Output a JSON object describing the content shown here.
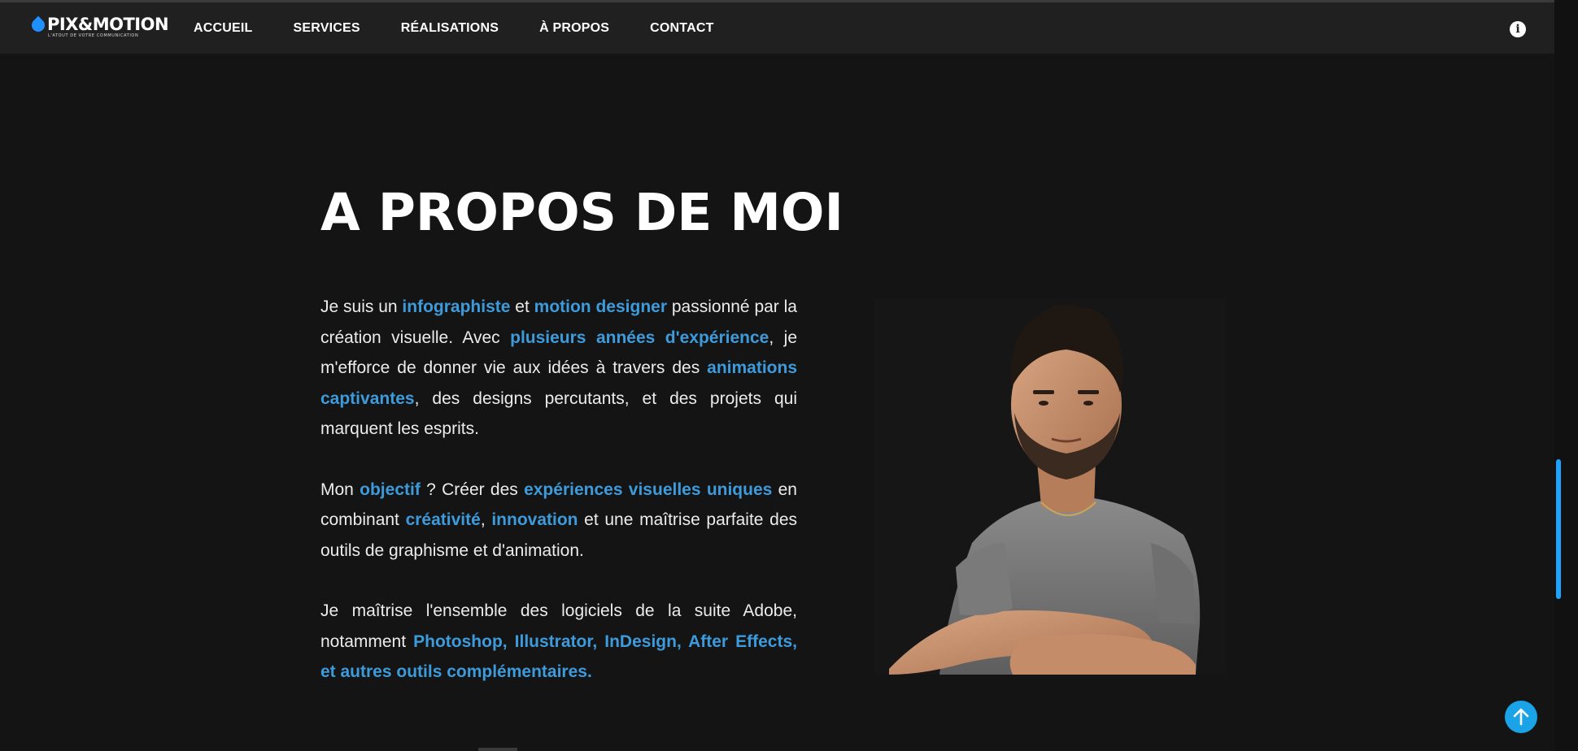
{
  "header": {
    "logo_text": "PIX&MOTION",
    "logo_tagline": "L'ATOUT DE VOTRE COMMUNICATION",
    "nav": [
      {
        "label": "ACCUEIL"
      },
      {
        "label": "SERVICES"
      },
      {
        "label": "RÉALISATIONS"
      },
      {
        "label": "À PROPOS"
      },
      {
        "label": "CONTACT"
      }
    ],
    "info_icon": "info-icon",
    "info_glyph": "i"
  },
  "about": {
    "title": "A PROPOS DE MOI",
    "p1": {
      "t1": "Je suis un ",
      "h1": "infographiste",
      "t2": " et ",
      "h2": "motion designer",
      "t3": " passionné par la création visuelle. Avec ",
      "h3": "plusieurs années d'expérience",
      "t4": ", je m'efforce de donner vie aux idées à travers des ",
      "h4": "animations captivantes",
      "t5": ", des designs percutants, et des projets qui marquent les esprits."
    },
    "p2": {
      "t1": "Mon ",
      "h1": "objectif",
      "t2": " ? Créer des ",
      "h2": "expériences visuelles uniques",
      "t3": " en combinant ",
      "h3": "créativité",
      "t4": ", ",
      "h4": "innovation",
      "t5": " et une maîtrise parfaite des outils de graphisme et d'animation."
    },
    "p3": {
      "t1": "Je maîtrise l'ensemble des logiciels de la suite Adobe, notamment ",
      "h1": "Photoshop, Illustrator, InDesign, After Effects, et autres outils complémentaires."
    },
    "portrait_icon": "portrait-photo"
  },
  "colors": {
    "background": "#141414",
    "header": "#202020",
    "accent": "#3d9bdc",
    "button": "#1aa3e6"
  },
  "back_to_top_icon": "arrow-up-icon"
}
